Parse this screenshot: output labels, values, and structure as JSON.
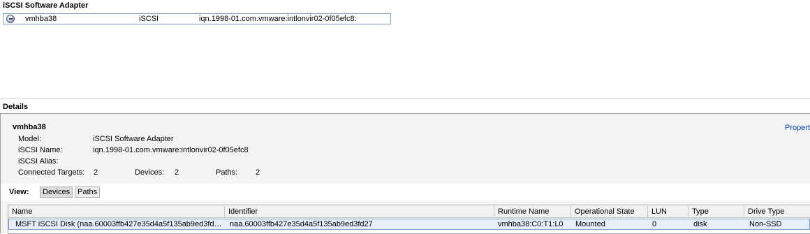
{
  "adapter_list": {
    "title": "iSCSI Software Adapter",
    "rows": [
      {
        "icon": "iscsi-adapter-icon",
        "device": "vmhba38",
        "type": "iSCSI",
        "wwn": "iqn.1998-01.com.vmware:intlonvir02-0f05efc8:"
      }
    ]
  },
  "details": {
    "title": "Details",
    "adapter_name": "vmhba38",
    "properties_link": "Propert",
    "model_label": "Model:",
    "model_value": "iSCSI Software Adapter",
    "iscsi_name_label": "iSCSI Name:",
    "iscsi_name_value": "iqn.1998-01.com.vmware:intlonvir02-0f05efc8",
    "iscsi_alias_label": "iSCSI Alias:",
    "iscsi_alias_value": "",
    "connected_targets_label": "Connected Targets:",
    "connected_targets_value": "2",
    "devices_label": "Devices:",
    "devices_value": "2",
    "paths_label": "Paths:",
    "paths_value": "2"
  },
  "view": {
    "label": "View:",
    "devices_button": "Devices",
    "paths_button": "Paths",
    "selected": "Devices"
  },
  "devices_table": {
    "columns": [
      "Name",
      "Identifier",
      "Runtime Name",
      "Operational State",
      "LUN",
      "Type",
      "Drive Type"
    ],
    "rows": [
      [
        "MSFT iSCSI Disk (naa.60003ffb427e35d4a5f135ab9ed3fd…",
        "naa.60003ffb427e35d4a5f135ab9ed3fd27",
        "vmhba38:C0:T1:L0",
        "Mounted",
        "0",
        "disk",
        "Non-SSD"
      ]
    ]
  },
  "colors": {
    "selection_border": "#7da2ce",
    "selection_fill": "#e6eef9",
    "link": "#0645ad",
    "panel_bg": "#f4f4f4"
  }
}
